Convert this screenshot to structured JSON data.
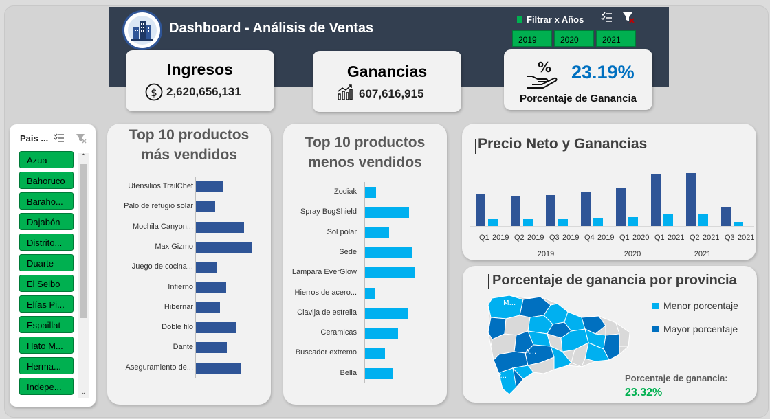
{
  "header": {
    "title": "Dashboard - Análisis de Ventas",
    "filter_label": "Filtrar x Años",
    "years": [
      "2019",
      "2020",
      "2021"
    ]
  },
  "kpis": {
    "ingresos": {
      "label": "Ingresos",
      "value": "2,620,656,131"
    },
    "ganancias": {
      "label": "Ganancias",
      "value": "607,616,915"
    },
    "porcentaje": {
      "label": "Porcentaje de Ganancia",
      "value": "23.19%"
    }
  },
  "slicer": {
    "title": "Pais ...",
    "items": [
      "Azua",
      "Bahoruco",
      "Baraho...",
      "Dajabón",
      "Distrito...",
      "Duarte",
      "El Seibo",
      "Elías Pi...",
      "Espaillat",
      "Hato M...",
      "Herma...",
      "Indepe..."
    ]
  },
  "top_products": {
    "title_line1": "Top 10 productos",
    "title_line2": "más vendidos",
    "chart_data": {
      "type": "bar",
      "orientation": "horizontal",
      "categories": [
        "Utensilios TrailChef",
        "Palo de refugio solar",
        "Mochila Canyon...",
        "Max Gizmo",
        "Juego de cocina...",
        "Infierno",
        "Hibernar",
        "Doble filo",
        "Dante",
        "Aseguramiento de..."
      ],
      "values": [
        39,
        28,
        70,
        81,
        31,
        44,
        35,
        58,
        45,
        66
      ],
      "color": "#2f5597"
    }
  },
  "bottom_products": {
    "title_line1": "Top 10 productos",
    "title_line2": "menos vendidos",
    "chart_data": {
      "type": "bar",
      "orientation": "horizontal",
      "categories": [
        "Zodiak",
        "Spray BugShield",
        "Sol polar",
        "Sede",
        "Lámpara EverGlow",
        "Hierros de acero...",
        "Clavija de estrella",
        "Ceramicas",
        "Buscador extremo",
        "Bella"
      ],
      "values": [
        16,
        64,
        35,
        69,
        73,
        14,
        63,
        48,
        29,
        41
      ],
      "color": "#00b0f0"
    }
  },
  "price_chart": {
    "title": "Precio Neto y Ganancias",
    "chart_data": {
      "type": "bar",
      "categories": [
        "Q1 2019",
        "Q2 2019",
        "Q3 2019",
        "Q4 2019",
        "Q1 2020",
        "Q1 2021",
        "Q2 2021",
        "Q3 2021"
      ],
      "quarters": [
        "Q1",
        "Q2",
        "Q3",
        "Q4",
        "Q1",
        "Q1",
        "Q2",
        "Q3"
      ],
      "quarter_years": [
        "2019",
        "2019",
        "2019",
        "2019",
        "2020",
        "2021",
        "2021",
        "2021"
      ],
      "groups": [
        "2019",
        "2020",
        "2021"
      ],
      "series": [
        {
          "values": [
            47,
            44,
            45,
            49,
            55,
            76,
            77,
            27
          ],
          "color": "#2f5597"
        },
        {
          "values": [
            10,
            10,
            10,
            11,
            13,
            18,
            18,
            6
          ],
          "color": "#00b0f0"
        }
      ]
    }
  },
  "map_panel": {
    "title": "Porcentaje de ganancia por provincia",
    "legend": [
      {
        "label": "Menor porcentaje",
        "color": "#00b0f0"
      },
      {
        "label": "Mayor porcentaje",
        "color": "#0070c0"
      }
    ],
    "map_labels": [
      "M...",
      "A...",
      "P..."
    ],
    "metric_label": "Porcentaje de ganancia:",
    "metric_value": "23.32%"
  }
}
